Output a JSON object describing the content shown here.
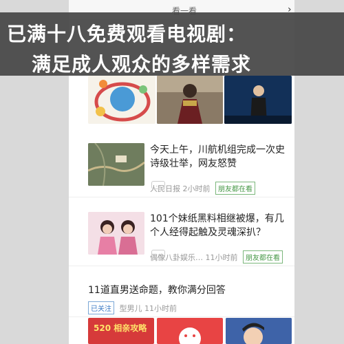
{
  "header": {
    "title": "看一看",
    "back_icon": "chevron-right-icon"
  },
  "banner": {
    "line1": "已满十八免费观看电视剧：",
    "line2": "满足成人观众的多样需求"
  },
  "feed": [
    {
      "title": "今天上午，川航机组完成一次史诗级壮举，网友怒赞",
      "source": "人民日报",
      "time": "2小时前",
      "tag": "朋友都在看"
    },
    {
      "title": "101个妹纸黑料相继被爆，有几个人经得起触及灵魂深扒？",
      "source": "偶像八卦娱乐…",
      "time": "11小时前",
      "tag": "朋友都在看"
    },
    {
      "title": "11道直男送命题，教你满分回答",
      "source": "型男儿",
      "time": "11小时前",
      "tag": "已关注"
    }
  ],
  "bottom_banner": {
    "label": "520 相亲攻略"
  },
  "colors": {
    "banner_bg": "#464646",
    "tag_green": "#4a9a4a",
    "page_bg": "#ffffff"
  }
}
